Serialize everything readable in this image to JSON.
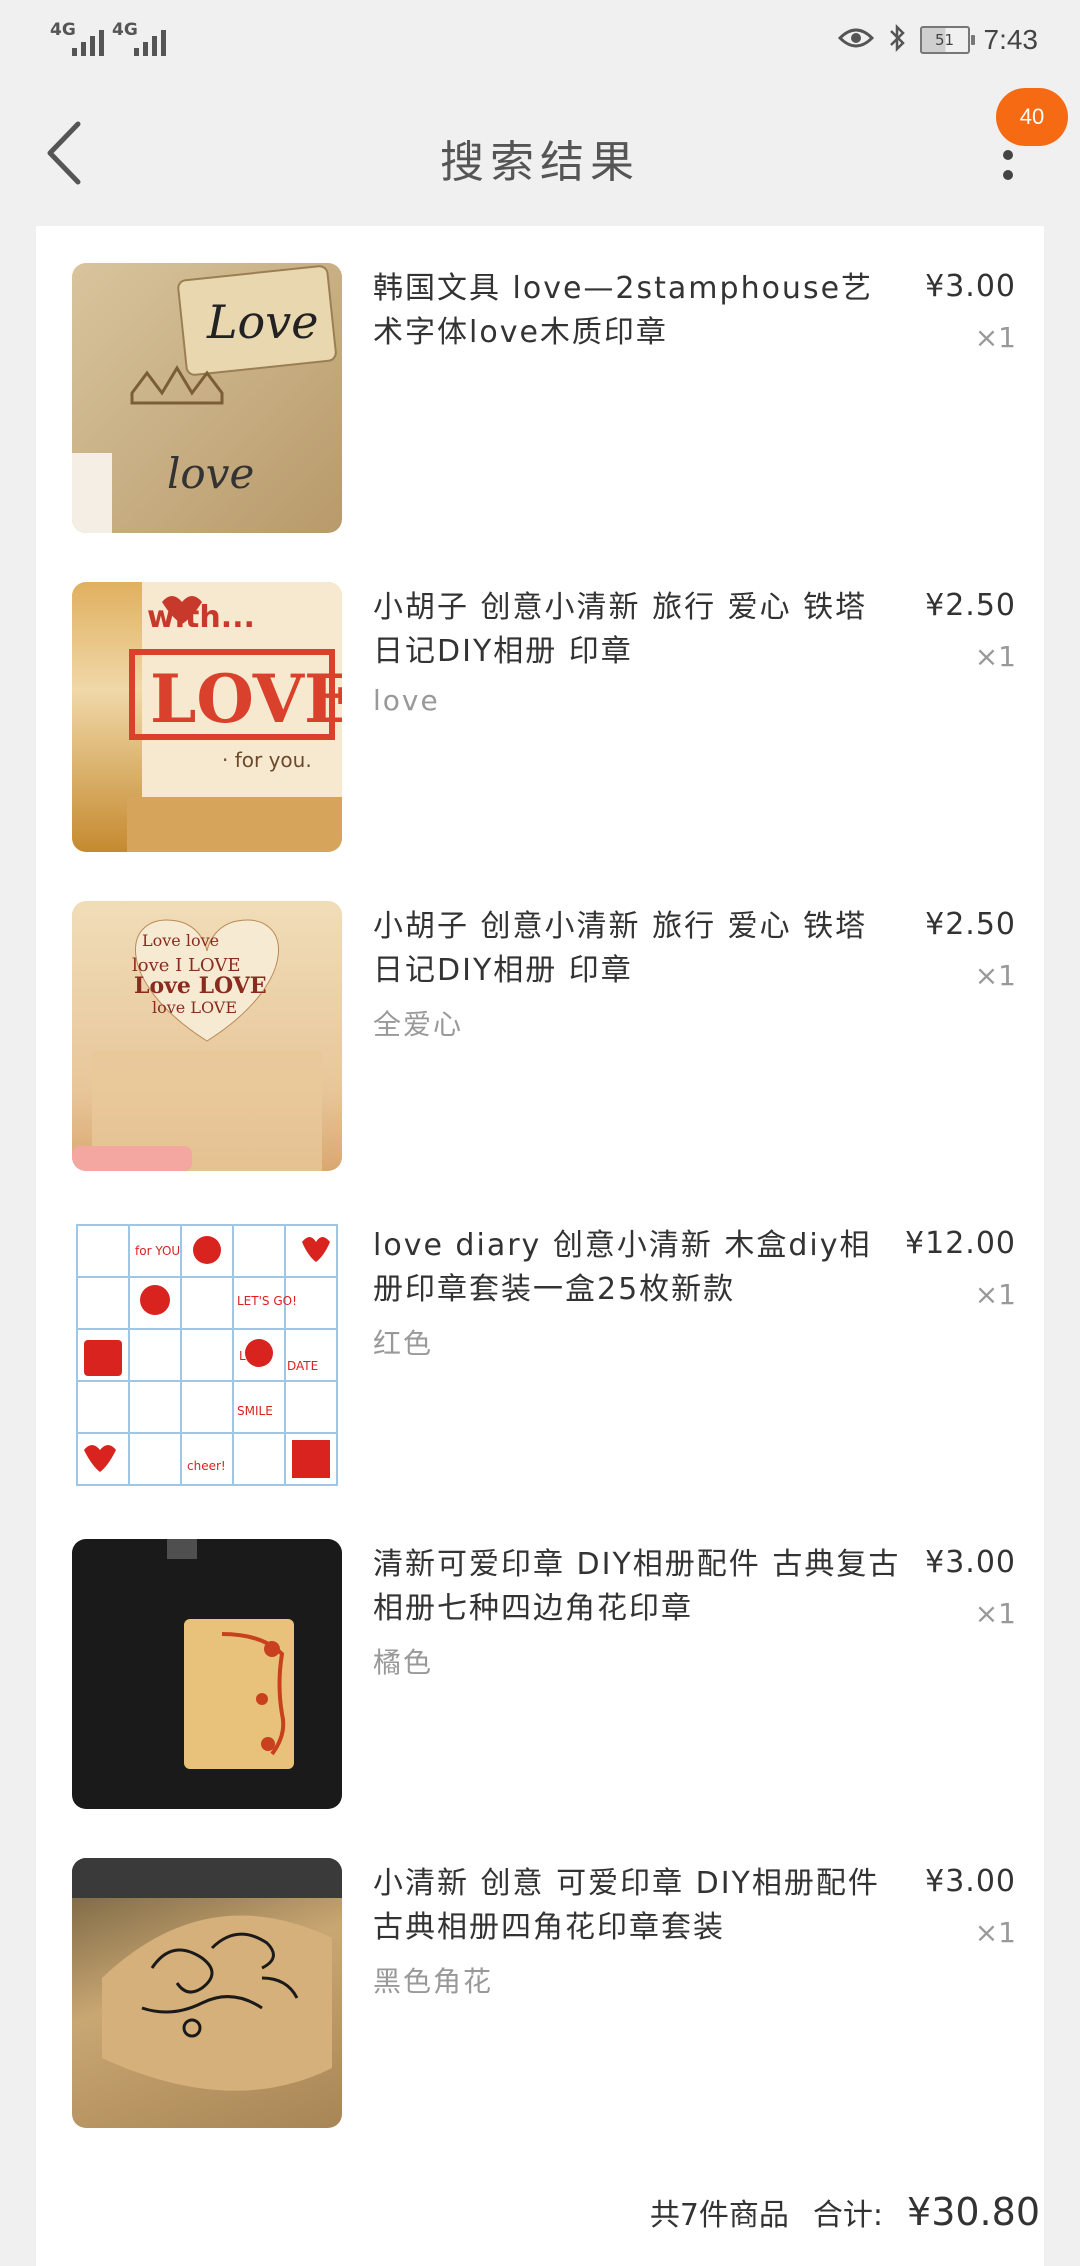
{
  "status_bar": {
    "signal_1": "4G",
    "signal_2": "4G",
    "battery": "51",
    "time": "7:43"
  },
  "nav": {
    "title": "搜索结果",
    "badge_count": "40"
  },
  "colors": {
    "accent": "#f56a12",
    "background": "#f0f0f0",
    "card": "#ffffff",
    "muted_text": "#999999"
  },
  "products": [
    {
      "name": "韩国文具 love—2stamphouse艺术字体love木质印章",
      "variant": "",
      "price": "¥3.00",
      "qty": "×1"
    },
    {
      "name": "小胡子 创意小清新  旅行  爱心 铁塔 日记DIY相册  印章",
      "variant": "love",
      "price": "¥2.50",
      "qty": "×1"
    },
    {
      "name": "小胡子 创意小清新  旅行  爱心 铁塔 日记DIY相册  印章",
      "variant": "全爱心",
      "price": "¥2.50",
      "qty": "×1"
    },
    {
      "name": "love diary 创意小清新 木盒diy相册印章套装一盒25枚新款",
      "variant": "红色",
      "price": "¥12.00",
      "qty": "×1"
    },
    {
      "name": "清新可爱印章 DIY相册配件 古典复古相册七种四边角花印章",
      "variant": "橘色",
      "price": "¥3.00",
      "qty": "×1"
    },
    {
      "name": "小清新 创意 可爱印章 DIY相册配件 古典相册四角花印章套装",
      "variant": "黑色角花",
      "price": "¥3.00",
      "qty": "×1"
    }
  ],
  "footer": {
    "count_text": "共7件商品",
    "total_label": "合计:",
    "total_value": "¥30.80"
  }
}
